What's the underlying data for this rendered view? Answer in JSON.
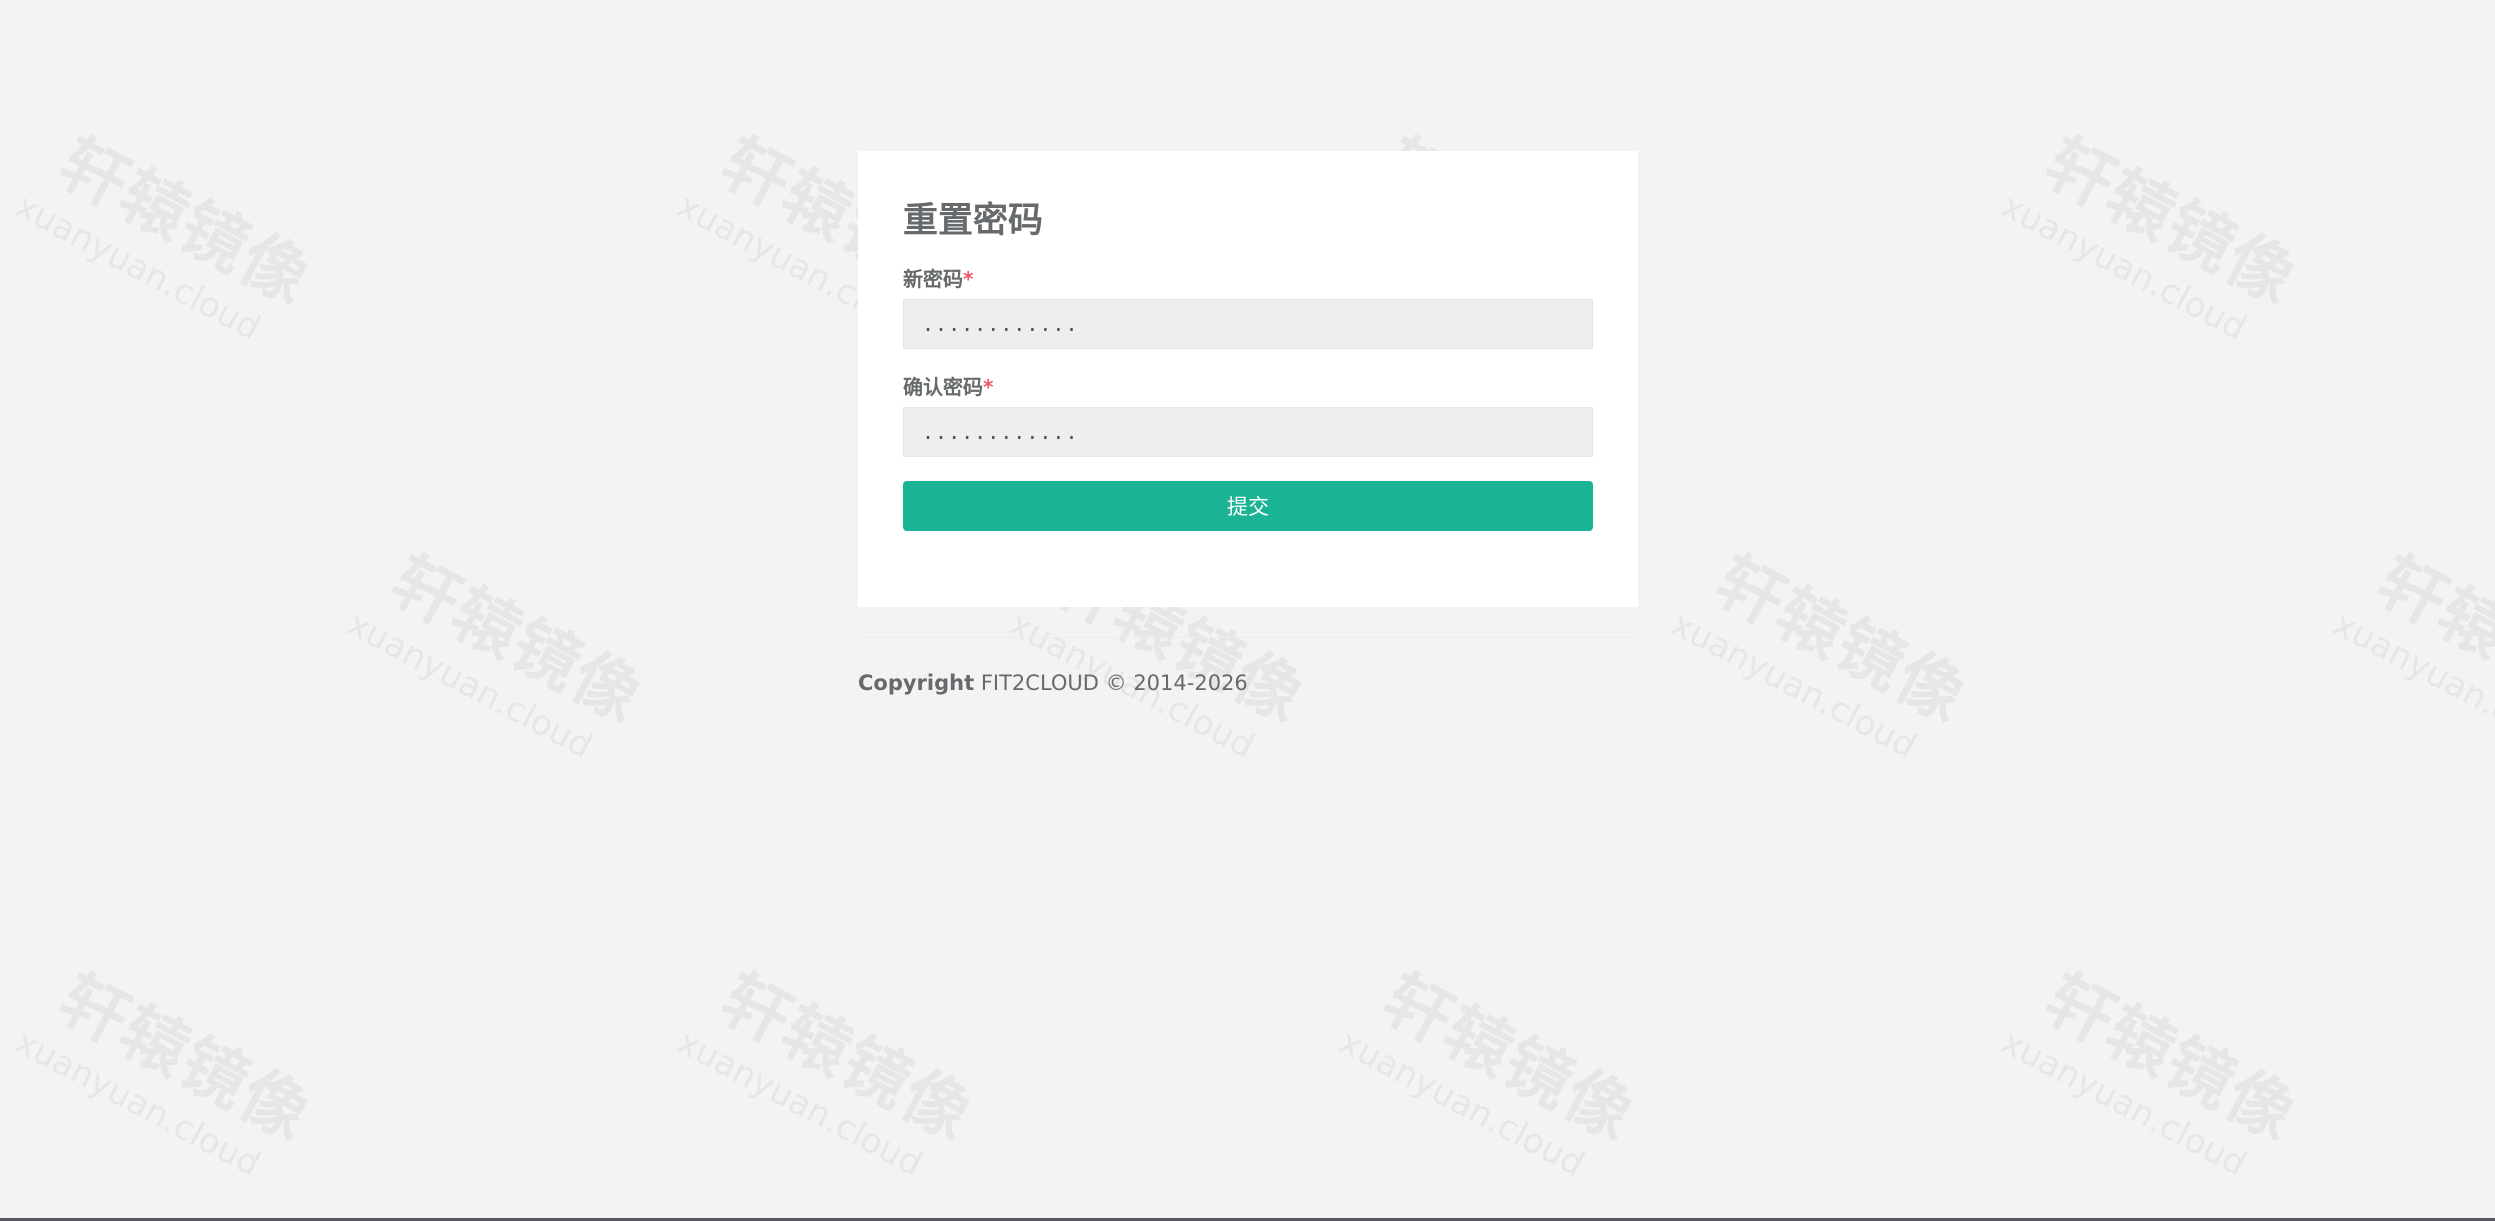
{
  "watermark": {
    "text_cn": "轩辕镜像",
    "text_en": "xuanyuan.cloud"
  },
  "form": {
    "title": "重置密码",
    "new_password_label": "新密码",
    "confirm_password_label": "确认密码",
    "required_mark": "*",
    "new_password_value": "............",
    "confirm_password_value": "............",
    "submit_label": "提交"
  },
  "footer": {
    "copyright_label": "Copyright",
    "company": "FIT2CLOUD © 2014-2026"
  },
  "colors": {
    "background": "#f3f3f4",
    "card": "#ffffff",
    "accent": "#1ab394",
    "required": "#ed5565",
    "text": "#676a6c"
  }
}
